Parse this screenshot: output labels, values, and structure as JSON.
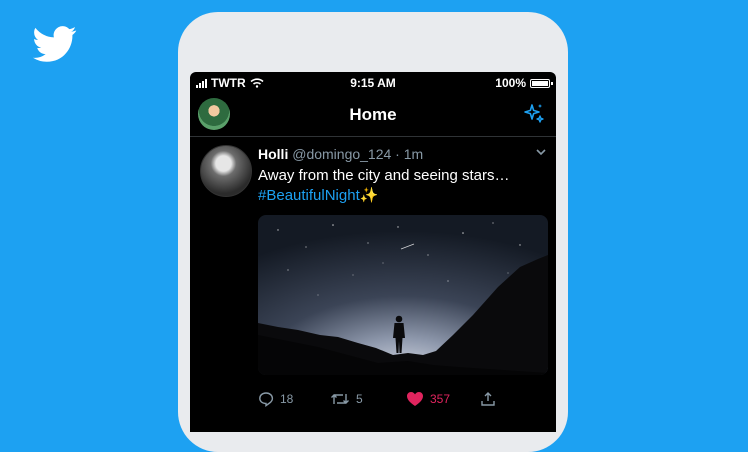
{
  "brand": {
    "background": "#1da1f2",
    "logo_icon": "twitter-bird-icon"
  },
  "status_bar": {
    "carrier": "TWTR",
    "time": "9:15 AM",
    "battery": "100%"
  },
  "header": {
    "title": "Home",
    "left_icon": "profile-avatar",
    "right_icon": "sparkle-icon"
  },
  "tweet": {
    "author_name": "Holli",
    "handle": "@domingo_124",
    "separator": " · ",
    "time": "1m",
    "text": "Away from the city and seeing stars…",
    "hashtag": "#BeautifulNight",
    "emoji": "✨",
    "media_description_icon": "night-sky-photo",
    "actions": {
      "replies": "18",
      "retweets": "5",
      "likes": "357"
    },
    "like_color": "#e0245e"
  }
}
